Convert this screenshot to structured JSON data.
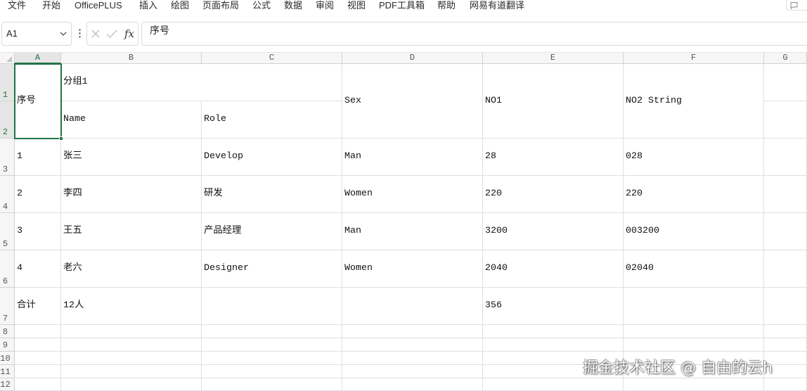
{
  "menu": [
    "文件",
    "开始",
    "OfficePLUS",
    "插入",
    "绘图",
    "页面布局",
    "公式",
    "数据",
    "审阅",
    "视图",
    "PDF工具箱",
    "帮助",
    "网易有道翻译"
  ],
  "top_right_button": {
    "icon": "comment-icon"
  },
  "formula_bar": {
    "name_box": "A1",
    "name_box_icon": "chevron-down-icon",
    "more_icon": "more-vertical-icon",
    "cancel_icon": "close-icon",
    "confirm_icon": "check-icon",
    "fx_label": "fx",
    "formula": "序号"
  },
  "sheet": {
    "columns": [
      "A",
      "B",
      "C",
      "D",
      "E",
      "F",
      "G"
    ],
    "row_numbers": [
      "1",
      "2",
      "3",
      "4",
      "5",
      "6",
      "7",
      "8",
      "9",
      "10",
      "11",
      "12"
    ],
    "cells": [
      [
        "序号",
        "分组1",
        "",
        "Sex",
        "NO1",
        "NO2 String",
        ""
      ],
      [
        "",
        "Name",
        "Role",
        "",
        "",
        "",
        ""
      ],
      [
        "1",
        "张三",
        "Develop",
        "Man",
        "28",
        "028",
        ""
      ],
      [
        "2",
        "李四",
        "研发",
        "Women",
        "220",
        "220",
        ""
      ],
      [
        "3",
        "王五",
        "产品经理",
        "Man",
        "3200",
        "003200",
        ""
      ],
      [
        "4",
        "老六",
        "Designer",
        "Women",
        "2040",
        "02040",
        ""
      ],
      [
        "合计",
        "12人",
        "",
        "",
        "356",
        "",
        ""
      ]
    ]
  },
  "watermark": "掘金技术社区 @ 自由的云h",
  "colors": {
    "accent": "#217346",
    "gridline": "#dfdfdf"
  }
}
